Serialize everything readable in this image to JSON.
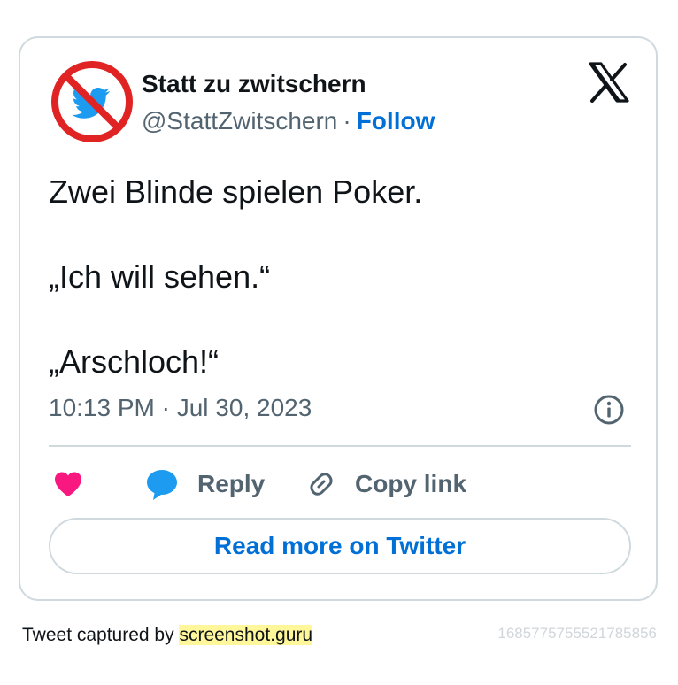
{
  "author": {
    "display_name": "Statt zu zwitschern",
    "handle": "@StattZwitschern",
    "separator": "·",
    "follow_label": "Follow",
    "avatar_icon": "no-twitter-bird-icon"
  },
  "tweet": {
    "lines": [
      "Zwei Blinde spielen Poker.",
      "„Ich will sehen.“",
      "„Arschloch!“"
    ],
    "timestamp": "10:13 PM · Jul 30, 2023"
  },
  "actions": {
    "like_icon": "heart-icon",
    "reply_label": "Reply",
    "copy_link_label": "Copy link"
  },
  "read_more_label": "Read more on Twitter",
  "footer": {
    "prefix": "Tweet captured by",
    "brand": "screenshot.guru",
    "tweet_id": "1685775755521785856"
  },
  "colors": {
    "accent": "#006fd6",
    "heart": "#f91880",
    "reply": "#1d9bf0",
    "muted": "#536471",
    "border": "#cfd9de"
  }
}
